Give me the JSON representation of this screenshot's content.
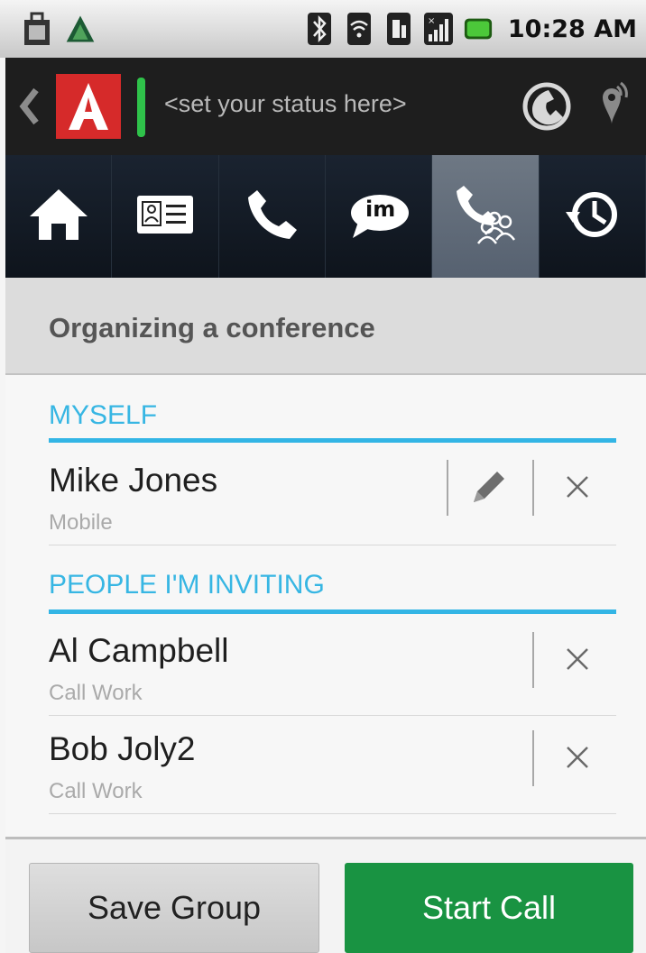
{
  "statusbar": {
    "time": "10:28 AM",
    "icons": [
      "bag-icon",
      "app-triangle-icon",
      "bluetooth-icon",
      "wifi-icon",
      "data-icon",
      "signal-icon",
      "battery-icon"
    ],
    "battery_color": "#4cc83a"
  },
  "header": {
    "logo_letter": "A",
    "logo_color": "#d62a2a",
    "presence_color": "#2fc24a",
    "status_placeholder": "<set your status here>",
    "icons": [
      "back-chevron-icon",
      "call-forward-icon",
      "location-icon"
    ]
  },
  "nav": {
    "items": [
      {
        "name": "home",
        "icon": "home-icon",
        "active": false
      },
      {
        "name": "contacts",
        "icon": "contact-card-icon",
        "active": false
      },
      {
        "name": "phone",
        "icon": "phone-icon",
        "active": false
      },
      {
        "name": "im",
        "icon": "im-bubble-icon",
        "active": false
      },
      {
        "name": "conference",
        "icon": "conference-icon",
        "active": true
      },
      {
        "name": "history",
        "icon": "history-icon",
        "active": false
      }
    ],
    "im_label": "im"
  },
  "page": {
    "title": "Organizing a conference"
  },
  "sections": {
    "myself": {
      "heading": "MYSELF",
      "person": {
        "name": "Mike Jones",
        "type": "Mobile"
      }
    },
    "invitees": {
      "heading": "PEOPLE I'M INVITING",
      "people": [
        {
          "name": "Al Campbell",
          "type": "Call Work"
        },
        {
          "name": "Bob Joly2",
          "type": "Call Work"
        }
      ]
    }
  },
  "footer": {
    "save_label": "Save Group",
    "start_label": "Start Call"
  },
  "colors": {
    "accent": "#33b5e5",
    "start_call": "#199342"
  }
}
